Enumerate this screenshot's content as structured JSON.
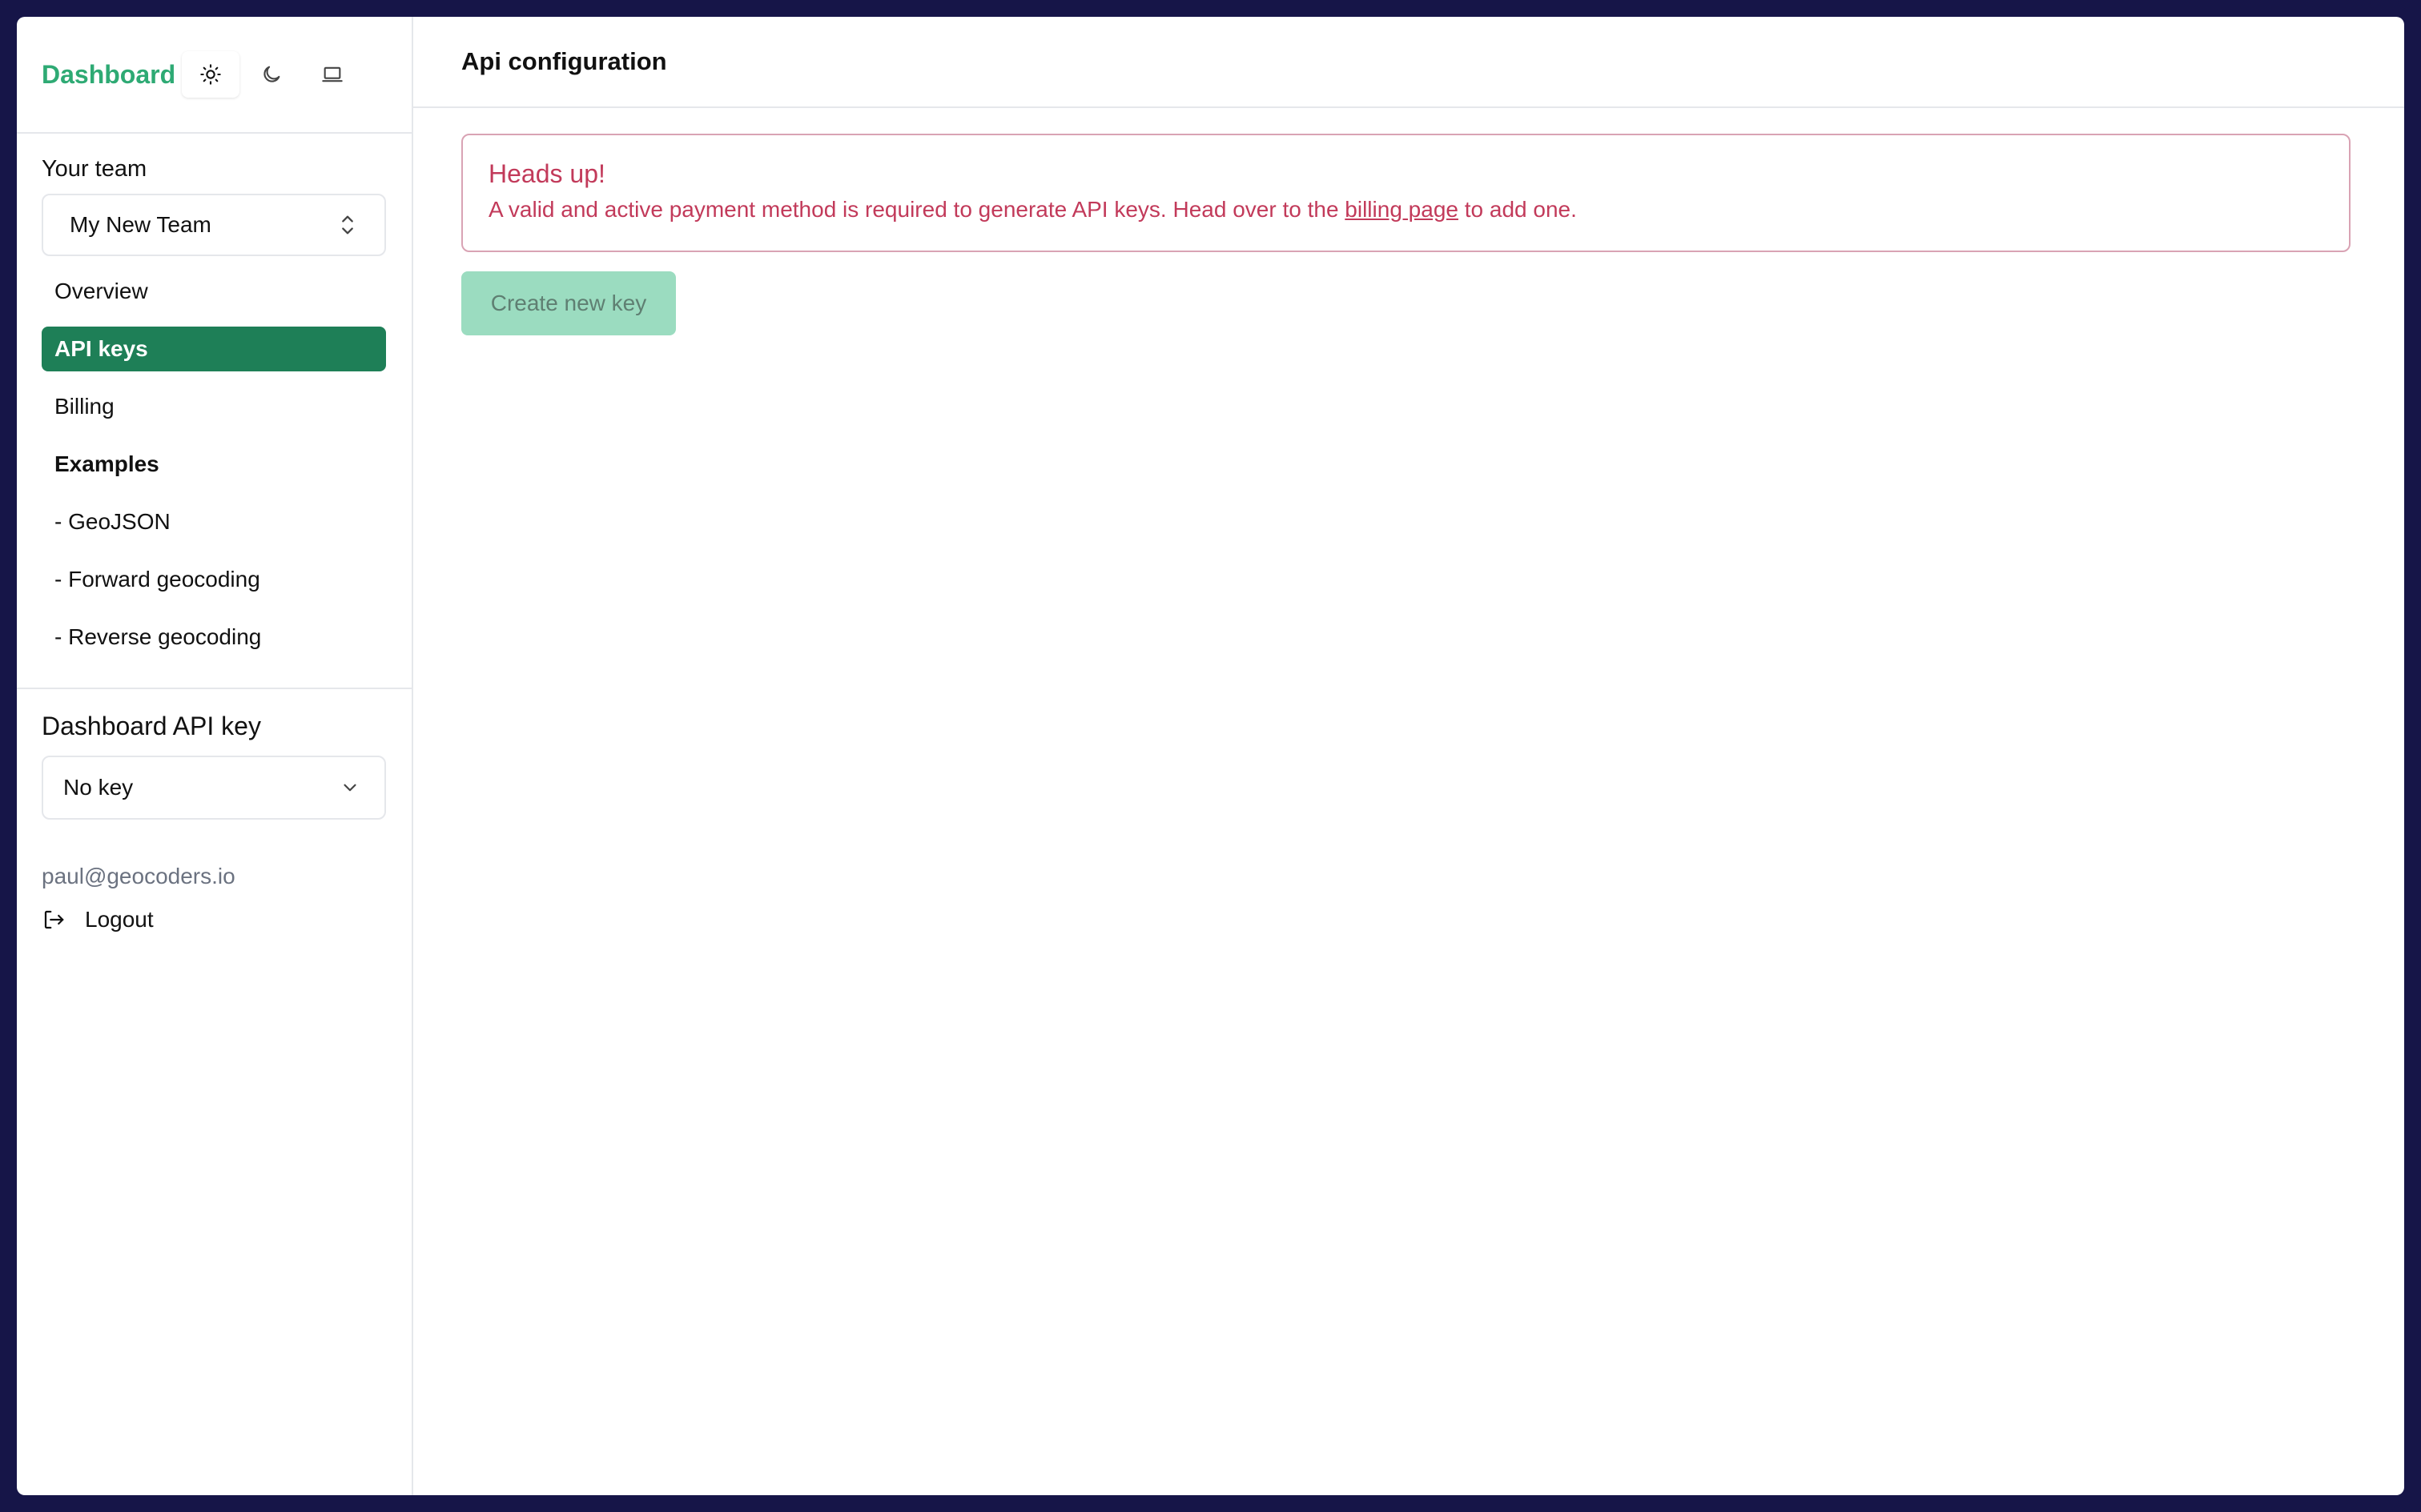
{
  "sidebar": {
    "brand": "Dashboard",
    "theme_buttons": [
      {
        "icon": "sun-icon",
        "active": true
      },
      {
        "icon": "moon-icon",
        "active": false
      },
      {
        "icon": "laptop-icon",
        "active": false
      }
    ],
    "team_label": "Your team",
    "team_value": "My New Team",
    "nav": [
      {
        "label": "Overview"
      },
      {
        "label": "API keys",
        "active": true
      },
      {
        "label": "Billing"
      },
      {
        "label": "Examples",
        "heading": true
      },
      {
        "label": "- GeoJSON"
      },
      {
        "label": "- Forward geocoding"
      },
      {
        "label": "- Reverse geocoding"
      }
    ],
    "api_key_label": "Dashboard API key",
    "api_key_value": "No key",
    "user_email": "paul@geocoders.io",
    "logout_label": "Logout"
  },
  "main": {
    "title": "Api configuration",
    "alert": {
      "title": "Heads up!",
      "text_before": "A valid and active payment method is required to generate API keys. Head over to the ",
      "link": "billing page",
      "text_after": " to add one."
    },
    "create_button": "Create new key"
  },
  "colors": {
    "brand": "#2eaa74",
    "active_nav": "#1e7f57",
    "alert": "#c23a5a",
    "button_disabled": "#9bdcc0",
    "frame": "#161548"
  }
}
